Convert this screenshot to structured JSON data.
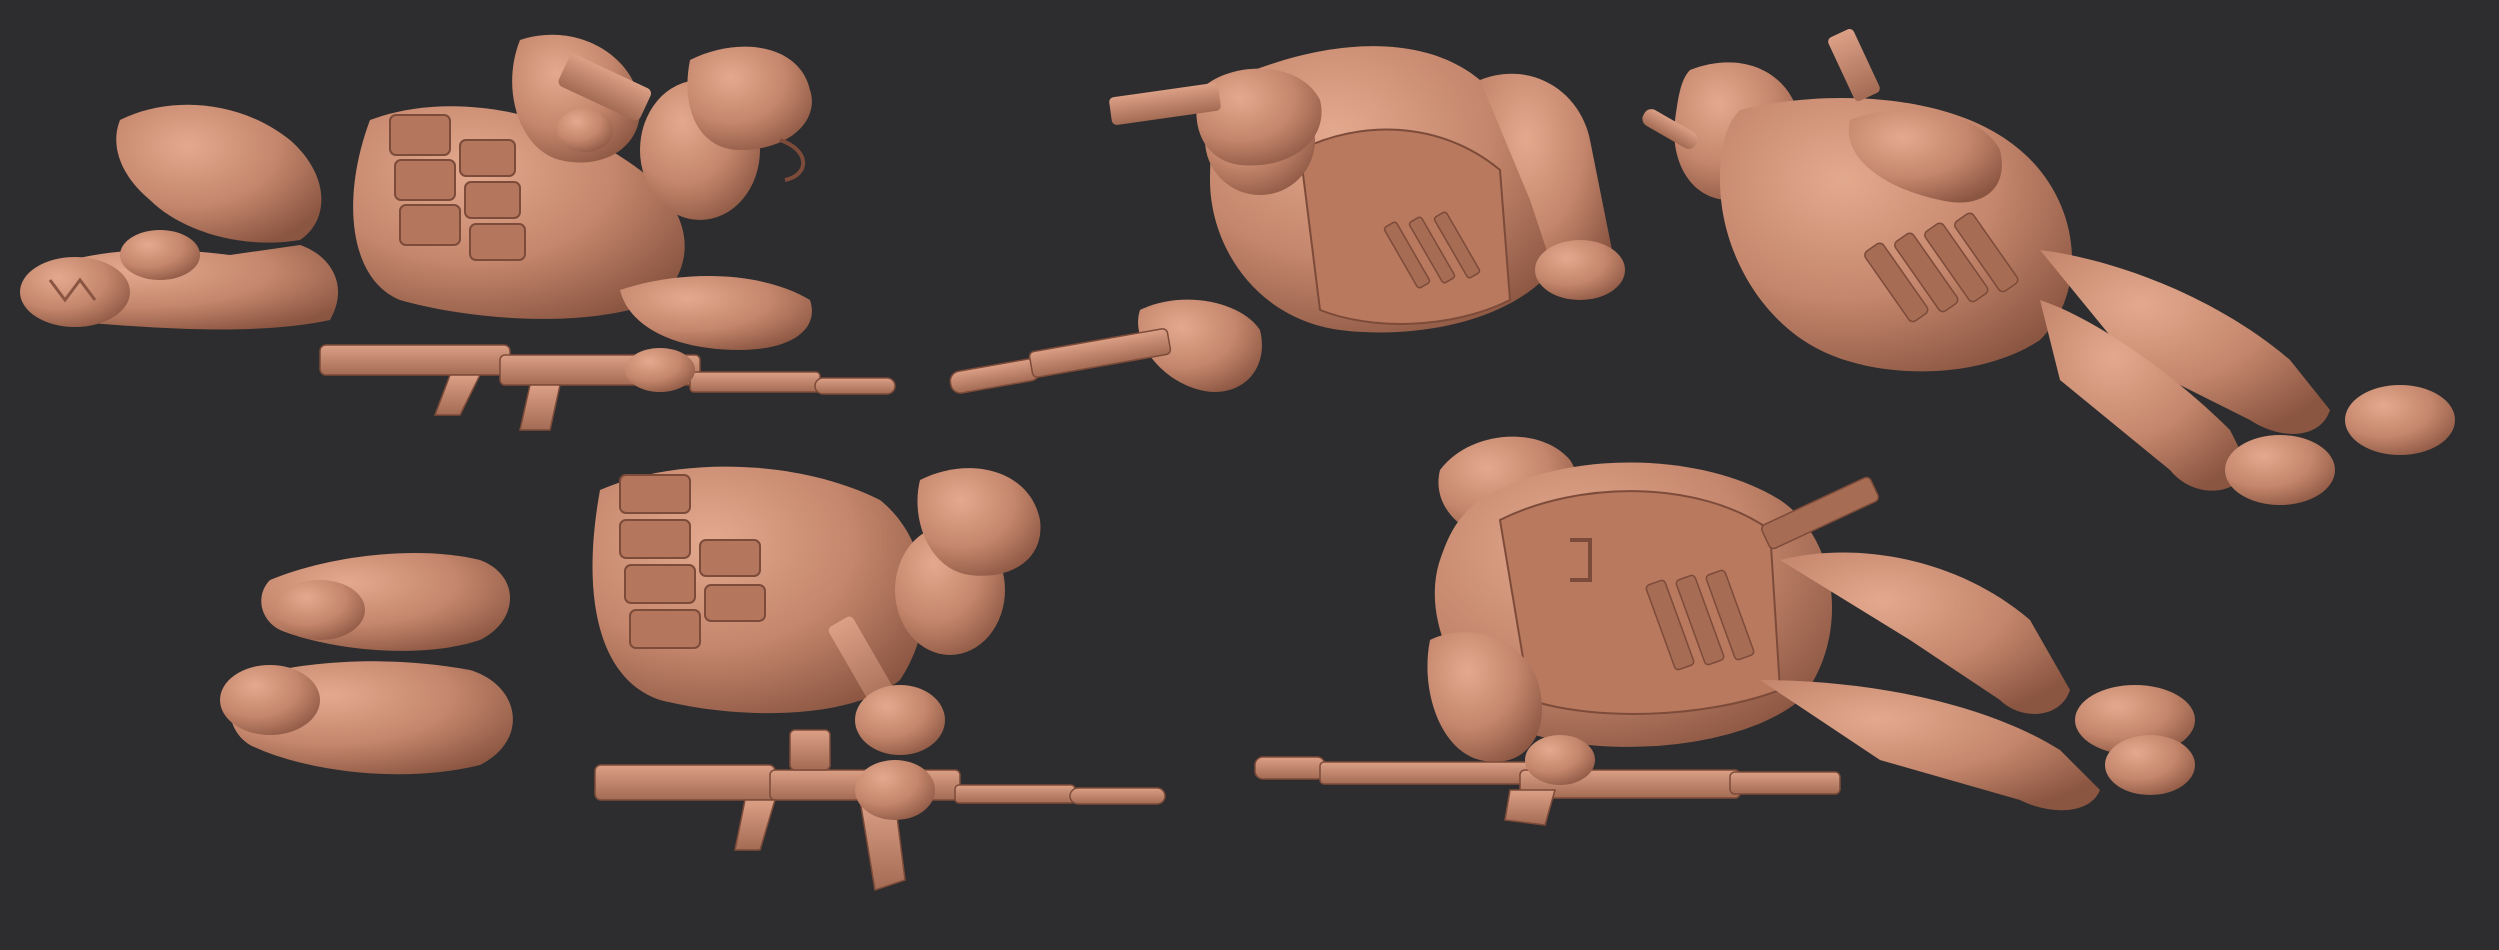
{
  "scene": {
    "background_color": "#2d2d2f",
    "material_color": "#c4866c",
    "material_shadow": "#8f5a45",
    "material_highlight": "#e0a58a"
  }
}
